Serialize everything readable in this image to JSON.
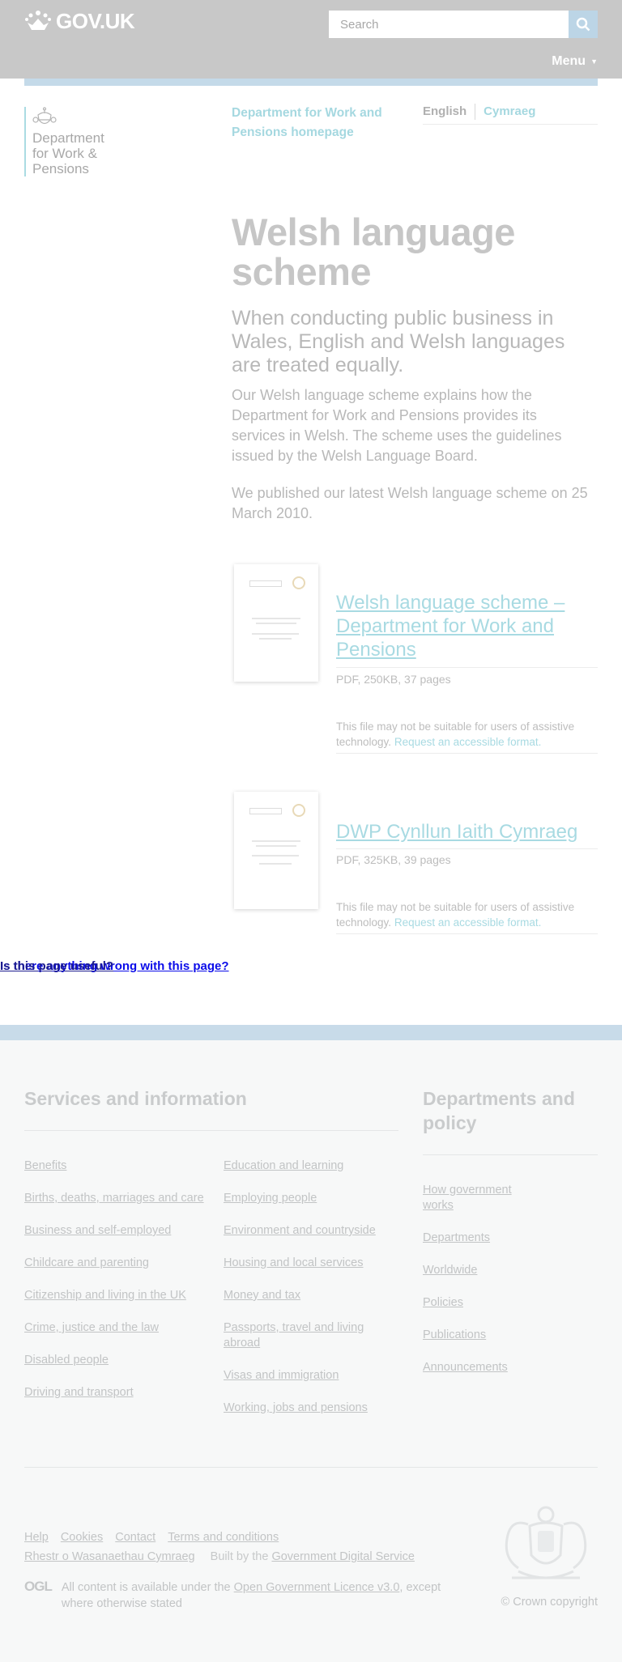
{
  "header": {
    "logo_text": "GOV.UK",
    "search_placeholder": "Search",
    "menu_label": "Menu",
    "colors": {
      "header_bg": "#c8c8c8",
      "accent_bar": "#c4dae9"
    }
  },
  "organisation": {
    "name": "Department for Work & Pensions",
    "homepage_link": "Department for Work and Pensions homepage"
  },
  "language": {
    "english": "English",
    "welsh": "Cymraeg"
  },
  "page": {
    "title": "Welsh language scheme",
    "lede": "When conducting public business in Wales, English and Welsh languages are treated equally.",
    "paragraphs": [
      "Our Welsh language scheme explains how the Department for Work and Pensions provides its services in Welsh. The scheme uses the guidelines issued by the Welsh Language Board.",
      "We published our latest Welsh language scheme on 25 March 2010."
    ]
  },
  "attachments": [
    {
      "title": "Welsh language scheme – Department for Work and Pensions",
      "meta": "PDF, 250KB, 37 pages",
      "note": "This file may not be suitable for users of assistive technology.",
      "request_link": "Request an accessible format."
    },
    {
      "title": "DWP Cynllun Iaith Cymraeg",
      "meta": "PDF, 325KB, 39 pages",
      "note": "This file may not be suitable for users of assistive technology.",
      "request_link": "Request an accessible format."
    }
  ],
  "feedback": {
    "link_a": "Is there anything wrong with this page?",
    "link_b": "Is this page useful?"
  },
  "footer": {
    "services_heading": "Services and information",
    "services_col1": [
      "Benefits",
      "Births, deaths, marriages and care",
      "Business and self-employed",
      "Childcare and parenting",
      "Citizenship and living in the UK",
      "Crime, justice and the law",
      "Disabled people",
      "Driving and transport"
    ],
    "services_col2": [
      "Education and learning",
      "Employing people",
      "Environment and countryside",
      "Housing and local services",
      "Money and tax",
      "Passports, travel and living abroad",
      "Visas and immigration",
      "Working, jobs and pensions"
    ],
    "departments_heading": "Departments and policy",
    "departments_links": [
      "How government works",
      "Departments",
      "Worldwide",
      "Policies",
      "Publications",
      "Announcements"
    ],
    "meta_links": [
      "Help",
      "Cookies",
      "Contact",
      "Terms and conditions",
      "Rhestr o Wasanaethau Cymraeg"
    ],
    "built_by_prefix": "Built by the",
    "built_by_link": "Government Digital Service",
    "ogl_logo": "OGL",
    "licence_prefix": "All content is available under the",
    "licence_link": "Open Government Licence v3.0",
    "licence_suffix": ", except where otherwise stated",
    "copyright": "© Crown copyright"
  }
}
